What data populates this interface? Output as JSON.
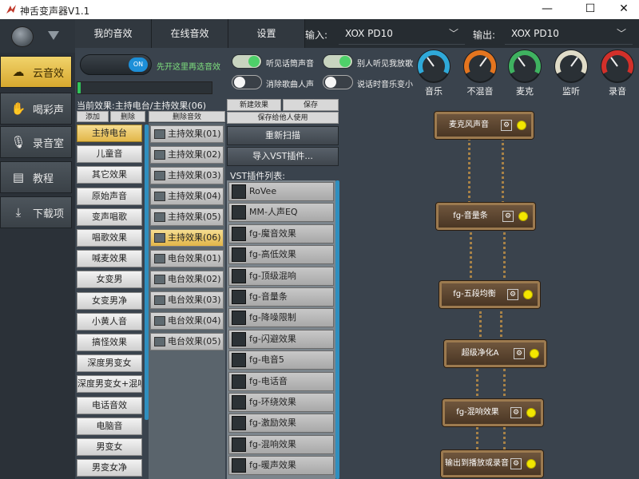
{
  "window": {
    "title": "神舌变声器V1.1",
    "min": "—",
    "max": "☐",
    "close": "✕"
  },
  "topbar": {
    "tabs": [
      "我的音效",
      "在线音效",
      "设置"
    ],
    "input_label": "输入:",
    "input_value": "XOX PD10",
    "output_label": "输出:",
    "output_value": "XOX PD10"
  },
  "nav": {
    "items": [
      {
        "label": "云音效",
        "icon": "cloud-icon",
        "active": true
      },
      {
        "label": "喝彩声",
        "icon": "hands-icon",
        "active": false
      },
      {
        "label": "录音室",
        "icon": "microphone-icon",
        "active": false
      },
      {
        "label": "教程",
        "icon": "book-icon",
        "active": false
      },
      {
        "label": "下载项",
        "icon": "download-icon",
        "active": false
      }
    ]
  },
  "main_toggle": {
    "label": "ON",
    "hint": "先开这里再选音效"
  },
  "switches": [
    {
      "label": "听见话筒声音",
      "on": true
    },
    {
      "label": "别人听见我放歌",
      "on": true
    },
    {
      "label": "消除歌曲人声",
      "on": false
    },
    {
      "label": "说话时音乐变小",
      "on": false
    }
  ],
  "gauges": [
    {
      "label": "音乐",
      "color": "#2fa9d9"
    },
    {
      "label": "不混音",
      "color": "#e4751f"
    },
    {
      "label": "麦克",
      "color": "#3fb260"
    },
    {
      "label": "监听",
      "color": "#e0dcc8"
    },
    {
      "label": "录音",
      "color": "#d3302a"
    }
  ],
  "effects": {
    "current": "当前效果:主持电台/主持效果(06)",
    "add": "添加",
    "delete": "删除",
    "delete_effect": "删除音效",
    "categories": [
      "主持电台",
      "儿童音",
      "其它效果",
      "原始声音",
      "变声唱歌",
      "唱歌效果",
      "喊麦效果",
      "女变男",
      "女变男净",
      "小黄人音",
      "搞怪效果",
      "深度男变女",
      "深度男变女+混响",
      "电话音效",
      "电脑音",
      "男变女",
      "男变女净"
    ],
    "selected_category": 0,
    "presets": [
      "主持效果(01)",
      "主持效果(02)",
      "主持效果(03)",
      "主持效果(04)",
      "主持效果(05)",
      "主持效果(06)",
      "电台效果(01)",
      "电台效果(02)",
      "电台效果(03)",
      "电台效果(04)",
      "电台效果(05)"
    ],
    "selected_preset": 5
  },
  "vst": {
    "new_effect": "新建效果",
    "save": "保存",
    "save_personal": "保存给他人使用",
    "rescan": "重新扫描",
    "import": "导入VST插件...",
    "list_title": "VST插件列表:",
    "plugins": [
      "RoVee",
      "MM-人声EQ",
      "fg-魔音效果",
      "fg-高低效果",
      "fg-顶级混响",
      "fg-音量条",
      "fg-降噪限制",
      "fg-闪避效果",
      "fg-电音5",
      "fg-电话音",
      "fg-环绕效果",
      "fg-激励效果",
      "fg-混响效果",
      "fg-暖声效果"
    ]
  },
  "chain": {
    "nodes": [
      "麦克风声音",
      "fg-音量条",
      "fg-五段均衡",
      "超级净化A",
      "fg-混响效果",
      "输出到播放或录音"
    ],
    "settings_glyph": "⚙"
  }
}
